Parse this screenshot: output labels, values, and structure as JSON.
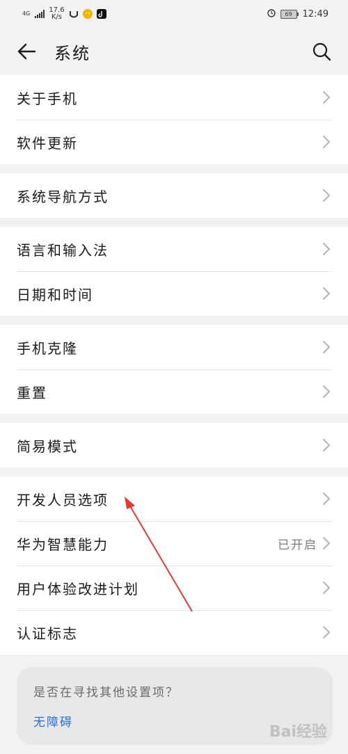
{
  "status_bar": {
    "network": "4G",
    "speed_value": "17.6",
    "speed_unit": "K/s",
    "battery": "69",
    "time": "12:49"
  },
  "header": {
    "title": "系统"
  },
  "groups": [
    [
      {
        "label": "关于手机"
      },
      {
        "label": "软件更新"
      }
    ],
    [
      {
        "label": "系统导航方式"
      }
    ],
    [
      {
        "label": "语言和输入法"
      },
      {
        "label": "日期和时间"
      }
    ],
    [
      {
        "label": "手机克隆"
      },
      {
        "label": "重置"
      }
    ],
    [
      {
        "label": "简易模式"
      }
    ],
    [
      {
        "label": "开发人员选项"
      },
      {
        "label": "华为智慧能力",
        "value": "已开启"
      },
      {
        "label": "用户体验改进计划"
      },
      {
        "label": "认证标志"
      }
    ]
  ],
  "find_card": {
    "question": "是否在寻找其他设置项？",
    "link": "无障碍"
  },
  "watermark": "Bai经验",
  "colors": {
    "background": "#f2f2f2",
    "link": "#2a6fd6",
    "annotation_arrow": "#e53935"
  }
}
